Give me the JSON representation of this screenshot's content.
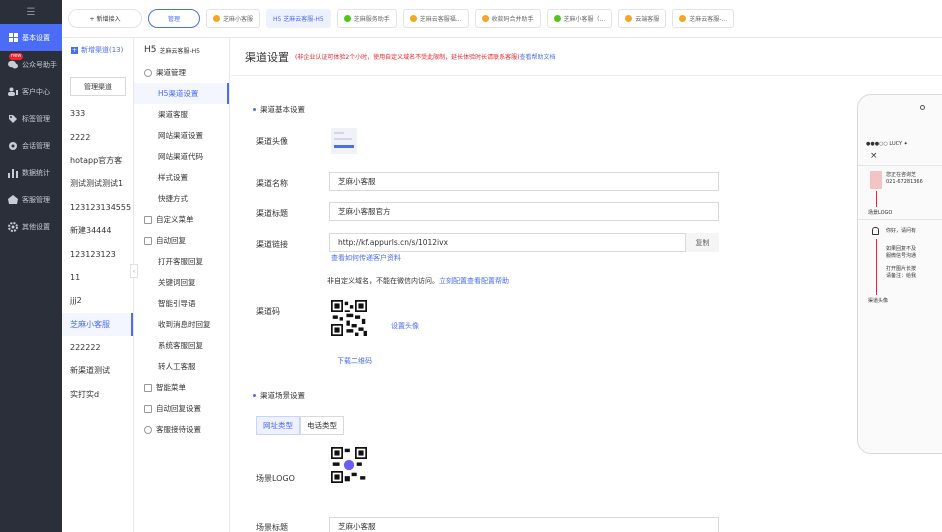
{
  "nav": {
    "logo": "☰",
    "items": [
      {
        "label": "基本设置",
        "icon": "grid-icon",
        "active": true
      },
      {
        "label": "公众号助手",
        "icon": "wechat-icon",
        "badge": "new"
      },
      {
        "label": "客户中心",
        "icon": "users-icon"
      },
      {
        "label": "标签管理",
        "icon": "tag-icon"
      },
      {
        "label": "会话管理",
        "icon": "chat-icon"
      },
      {
        "label": "数据统计",
        "icon": "bar-chart-icon"
      },
      {
        "label": "客服管理",
        "icon": "cloud-icon"
      },
      {
        "label": "其他设置",
        "icon": "gear-icon"
      }
    ]
  },
  "tabs": {
    "add": "+ 新增接入",
    "manage": "管理",
    "items": [
      {
        "label": "芝麻小客服",
        "color": "#f5a623"
      },
      {
        "label": "H5 芝麻云客服-H5",
        "current": true
      },
      {
        "label": "芝麻服务助手",
        "color": "#52c41a"
      },
      {
        "label": "芝麻云客服福...",
        "color": "#f5a623"
      },
      {
        "label": "收款码合并助手",
        "color": "#f5a623"
      },
      {
        "label": "芝麻小客服（...",
        "color": "#52c41a"
      },
      {
        "label": "云端客服",
        "color": "#f5a623"
      },
      {
        "label": "芝麻云客服-...",
        "color": "#f5a623"
      }
    ]
  },
  "channels": {
    "new_label": "新增渠道(13)",
    "manage_label": "管理渠道",
    "items": [
      "333",
      "2222",
      "hotapp官方客",
      "测试测试测试1",
      "123123134555",
      "新建34444",
      "123123123",
      "11",
      "jjj2",
      "芝麻小客服",
      "222222",
      "新渠道测试",
      "实打实d"
    ],
    "selected": 9
  },
  "submenu": {
    "header": "H5",
    "header_sub": "芝麻云客服-H5",
    "groups": [
      {
        "label": "渠道管理",
        "icon": "circle-icon",
        "subs": [
          "H5渠道设置",
          "渠道客服",
          "网站渠道设置",
          "网站渠道代码",
          "样式设置",
          "快捷方式"
        ]
      },
      {
        "label": "自定义菜单",
        "icon": "menu-icon",
        "subs": []
      },
      {
        "label": "自动回复",
        "icon": "reply-icon",
        "subs": [
          "打开客服回复",
          "关键词回复",
          "智能引导语",
          "收到消息时回复",
          "系统客服回复",
          "转人工客服"
        ]
      },
      {
        "label": "智能菜单",
        "icon": "list-icon",
        "subs": []
      },
      {
        "label": "自动回复设置",
        "icon": "settings-icon",
        "subs": []
      },
      {
        "label": "客服接待设置",
        "icon": "headset-icon",
        "subs": []
      }
    ],
    "selected": "H5渠道设置"
  },
  "main": {
    "title": "渠道设置",
    "notice": "(非企业认证可体验2个小时，使用自定义域名不受此限制，延长体验时长请联系客服)",
    "notice_link": "查看帮助文档",
    "sec_basic": "渠道基本设置",
    "avatar_label": "渠道头像",
    "name_label": "渠道名称",
    "name_value": "芝麻小客服",
    "title_label": "渠道标题",
    "title_value": "芝麻小客服官方",
    "link_label": "渠道链接",
    "link_value": "http://kf.appurls.cn/s/1012ivx",
    "copy_label": "复制",
    "link_help": "查看如何传递客户资料",
    "domain_note": "非自定义域名，不能在微信内访问。",
    "domain_link1": "立刻配置",
    "domain_link2": "查看配置帮助",
    "qr_label": "渠道码",
    "qr_set": "设置头像",
    "qr_download": "下载二维码",
    "sec_scene": "渠道场景设置",
    "scene_tabs": [
      "网址类型",
      "电话类型"
    ],
    "scene_logo_label": "场景LOGO",
    "scene_title_label": "场景标题",
    "scene_title_value": "芝麻小客服"
  },
  "phone": {
    "status": "●●●○○ LUCY ✦",
    "close": "×",
    "msg1": "您正在咨询芝",
    "msg1b": "021-67281366",
    "ann1": "场景LOGO",
    "greet": "你好，请问有",
    "faq1": "如果回复不及",
    "faq1b": "服微信号沟通",
    "faq2": "打开图片长按",
    "faq2b": "请备注：给我",
    "ann2": "渠道头像"
  }
}
